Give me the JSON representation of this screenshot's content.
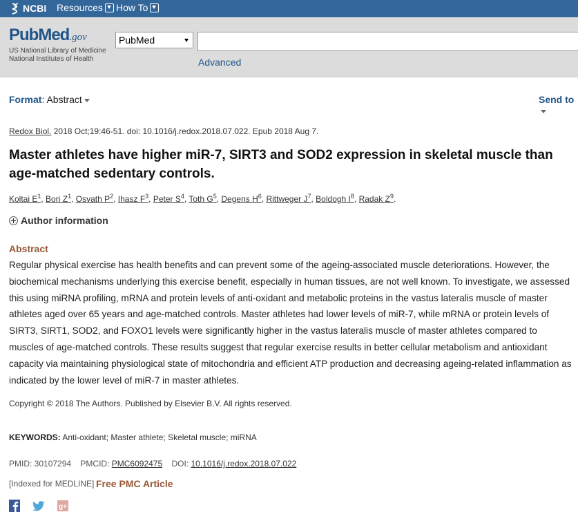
{
  "ncbi_bar": {
    "logo_label": "NCBI",
    "menu_resources": "Resources",
    "menu_howto": "How To"
  },
  "header": {
    "logo_word_a": "Pub",
    "logo_word_b": "Med",
    "logo_word_c": ".gov",
    "logo_line1": "US National Library of Medicine",
    "logo_line2": "National Institutes of Health",
    "db_selected": "PubMed",
    "search_value": "",
    "advanced": "Advanced"
  },
  "format_row": {
    "label": "Format",
    "value": ": Abstract",
    "send_to": "Send to"
  },
  "article": {
    "journal": "Redox Biol.",
    "citation_rest": " 2018 Oct;19:46-51. doi: 10.1016/j.redox.2018.07.022. Epub 2018 Aug 7.",
    "title": "Master athletes have higher miR-7, SIRT3 and SOD2 expression in skeletal muscle than age-matched sedentary controls.",
    "authors": [
      {
        "name": "Koltai E",
        "sup": "1"
      },
      {
        "name": "Bori Z",
        "sup": "1"
      },
      {
        "name": "Osvath P",
        "sup": "2"
      },
      {
        "name": "Ihasz F",
        "sup": "3"
      },
      {
        "name": "Peter S",
        "sup": "4"
      },
      {
        "name": "Toth G",
        "sup": "5"
      },
      {
        "name": "Degens H",
        "sup": "6"
      },
      {
        "name": "Rittweger J",
        "sup": "7"
      },
      {
        "name": "Boldogh I",
        "sup": "8"
      },
      {
        "name": "Radak Z",
        "sup": "9"
      }
    ],
    "author_info": "Author information",
    "abstract_heading": "Abstract",
    "abstract_text": "Regular physical exercise has health benefits and can prevent some of the ageing-associated muscle deteriorations. However, the biochemical mechanisms underlying this exercise benefit, especially in human tissues, are not well known. To investigate, we assessed this using miRNA profiling, mRNA and protein levels of anti-oxidant and metabolic proteins in the vastus lateralis muscle of master athletes aged over 65 years and age-matched controls. Master athletes had lower levels of miR-7, while mRNA or protein levels of SIRT3, SIRT1, SOD2, and FOXO1 levels were significantly higher in the vastus lateralis muscle of master athletes compared to muscles of age-matched controls. These results suggest that regular exercise results in better cellular metabolism and antioxidant capacity via maintaining physiological state of mitochondria and efficient ATP production and decreasing ageing-related inflammation as indicated by the lower level of miR-7 in master athletes.",
    "copyright": "Copyright © 2018 The Authors. Published by Elsevier B.V. All rights reserved.",
    "keywords_label": "KEYWORDS:",
    "keywords": " Anti-oxidant; Master athlete; Skeletal muscle; miRNA",
    "pmid": "PMID: 30107294",
    "pmcid_label": "PMCID: ",
    "pmcid": "PMC6092475",
    "doi_label": "DOI: ",
    "doi": "10.1016/j.redox.2018.07.022",
    "indexed": "[Indexed for MEDLINE]",
    "free_pmc": "Free PMC Article"
  },
  "social": [
    "facebook-icon",
    "twitter-icon",
    "google-plus-icon"
  ],
  "colors": {
    "nav_bar": "#336699",
    "header_band": "#dcdcdc",
    "link_blue": "#20558a",
    "accent_brown": "#985735"
  }
}
